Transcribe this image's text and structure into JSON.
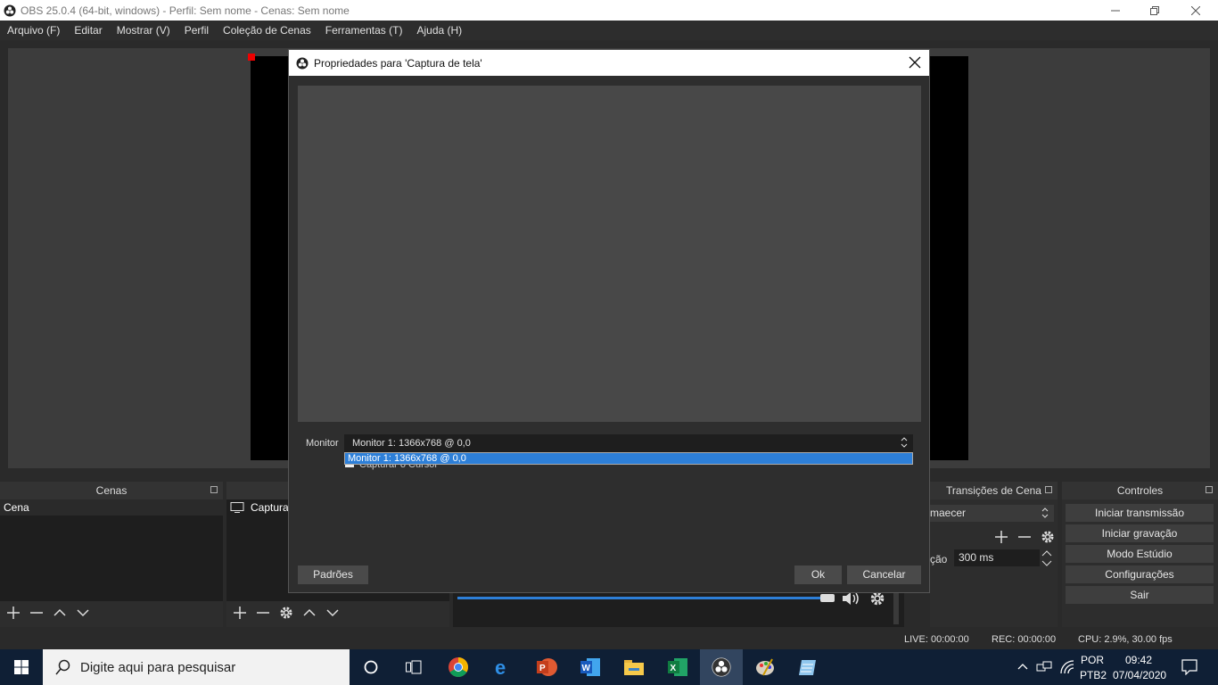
{
  "window": {
    "title": "OBS 25.0.4 (64-bit, windows) - Perfil: Sem nome - Cenas: Sem nome"
  },
  "menu": [
    "Arquivo (F)",
    "Editar",
    "Mostrar (V)",
    "Perfil",
    "Coleção de Cenas",
    "Ferramentas (T)",
    "Ajuda (H)"
  ],
  "docks": {
    "scenes": {
      "title": "Cenas",
      "items": [
        "Cena"
      ]
    },
    "sources": {
      "items": [
        "Captura"
      ]
    },
    "transitions": {
      "title": "Transições de Cena",
      "type_value": "maecer",
      "duration_label": "ção",
      "duration_value": "300 ms"
    },
    "controls": {
      "title": "Controles",
      "buttons": [
        "Iniciar transmissão",
        "Iniciar gravação",
        "Modo Estúdio",
        "Configurações",
        "Sair"
      ]
    }
  },
  "status": {
    "live": "LIVE: 00:00:00",
    "rec": "REC: 00:00:00",
    "cpu": "CPU: 2.9%, 30.00 fps"
  },
  "dialog": {
    "title": "Propriedades para 'Captura de tela'",
    "monitor_label": "Monitor",
    "monitor_value": "Monitor 1: 1366x768 @ 0,0",
    "dropdown_option": "Monitor 1: 1366x768 @ 0,0",
    "capture_cursor_label": "Capturar o Cursor",
    "defaults_button": "Padrões",
    "ok_button": "Ok",
    "cancel_button": "Cancelar"
  },
  "taskbar": {
    "search_placeholder": "Digite aqui para pesquisar",
    "lang": "POR",
    "layout": "PTB2",
    "time": "09:42",
    "date": "07/04/2020"
  },
  "colors": {
    "accent": "#2d7fd8",
    "dark_bg": "#2a2a2a",
    "taskbar": "#0f1f35"
  }
}
